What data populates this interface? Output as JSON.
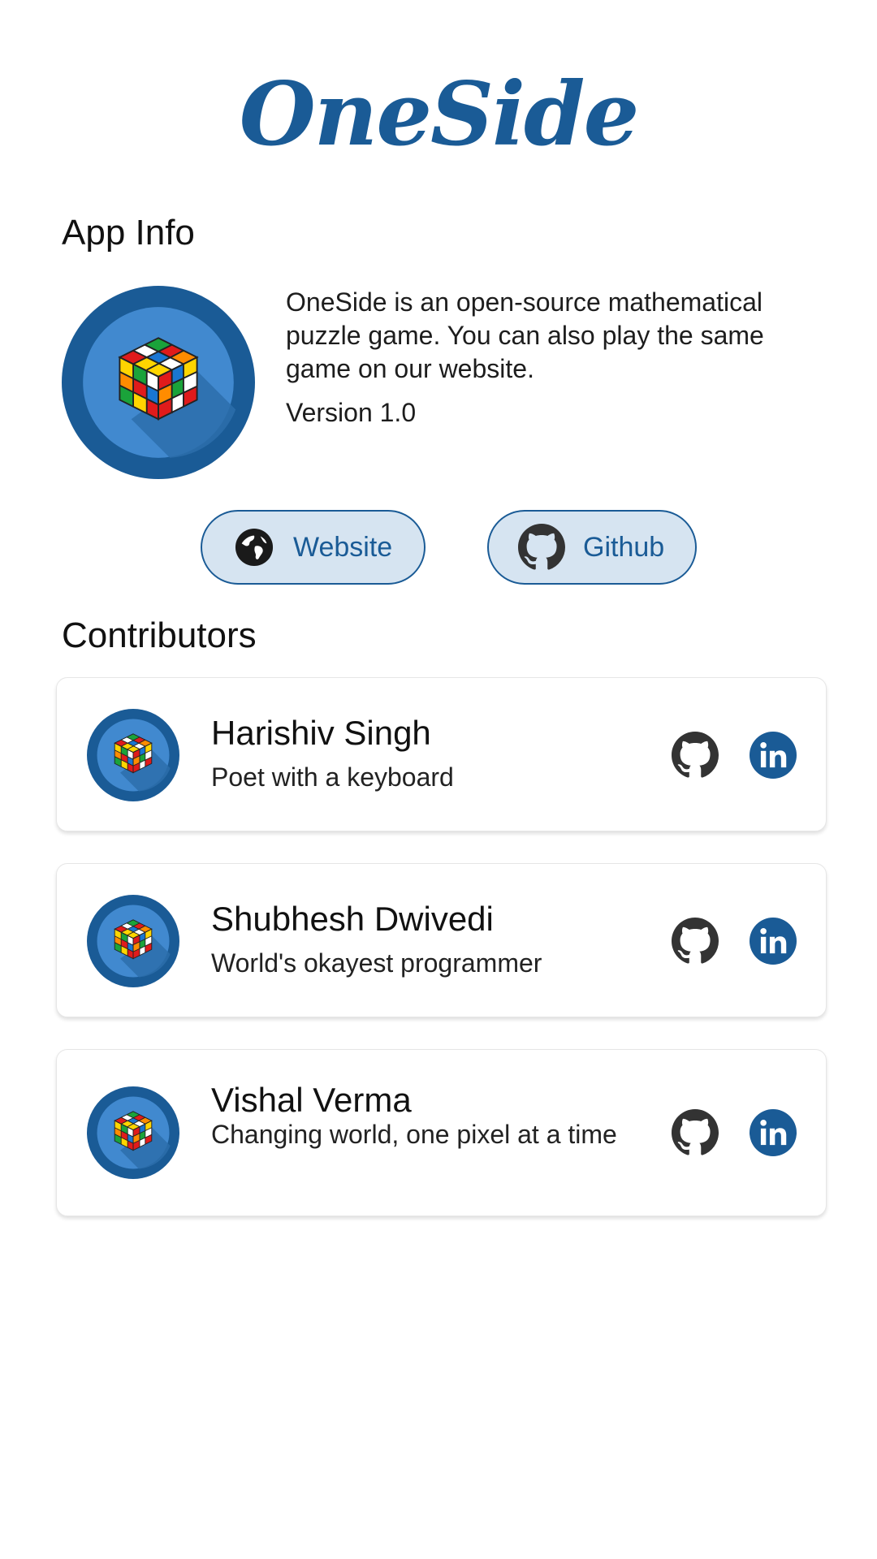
{
  "app": {
    "name": "OneSide"
  },
  "app_info": {
    "title": "App Info",
    "description": "OneSide is an open-source mathematical puzzle game. You can also play the same game on our website.",
    "version": "Version 1.0",
    "logo_icon": "rubiks-cube-logo"
  },
  "buttons": {
    "website": {
      "label": "Website",
      "icon": "globe-icon"
    },
    "github": {
      "label": "Github",
      "icon": "github-icon"
    }
  },
  "contributors_section": {
    "title": "Contributors"
  },
  "contributors": [
    {
      "name": "Harishiv Singh",
      "tagline": "Poet with a keyboard"
    },
    {
      "name": "Shubhesh Dwivedi",
      "tagline": "World's okayest programmer"
    },
    {
      "name": "Vishal Verma",
      "tagline": "Changing world, one pixel at a time"
    }
  ],
  "colors": {
    "brand": "#1a5b96",
    "button_fill": "#d6e4f1",
    "logo_inner": "#4189cf",
    "icon_dark": "#333333"
  }
}
